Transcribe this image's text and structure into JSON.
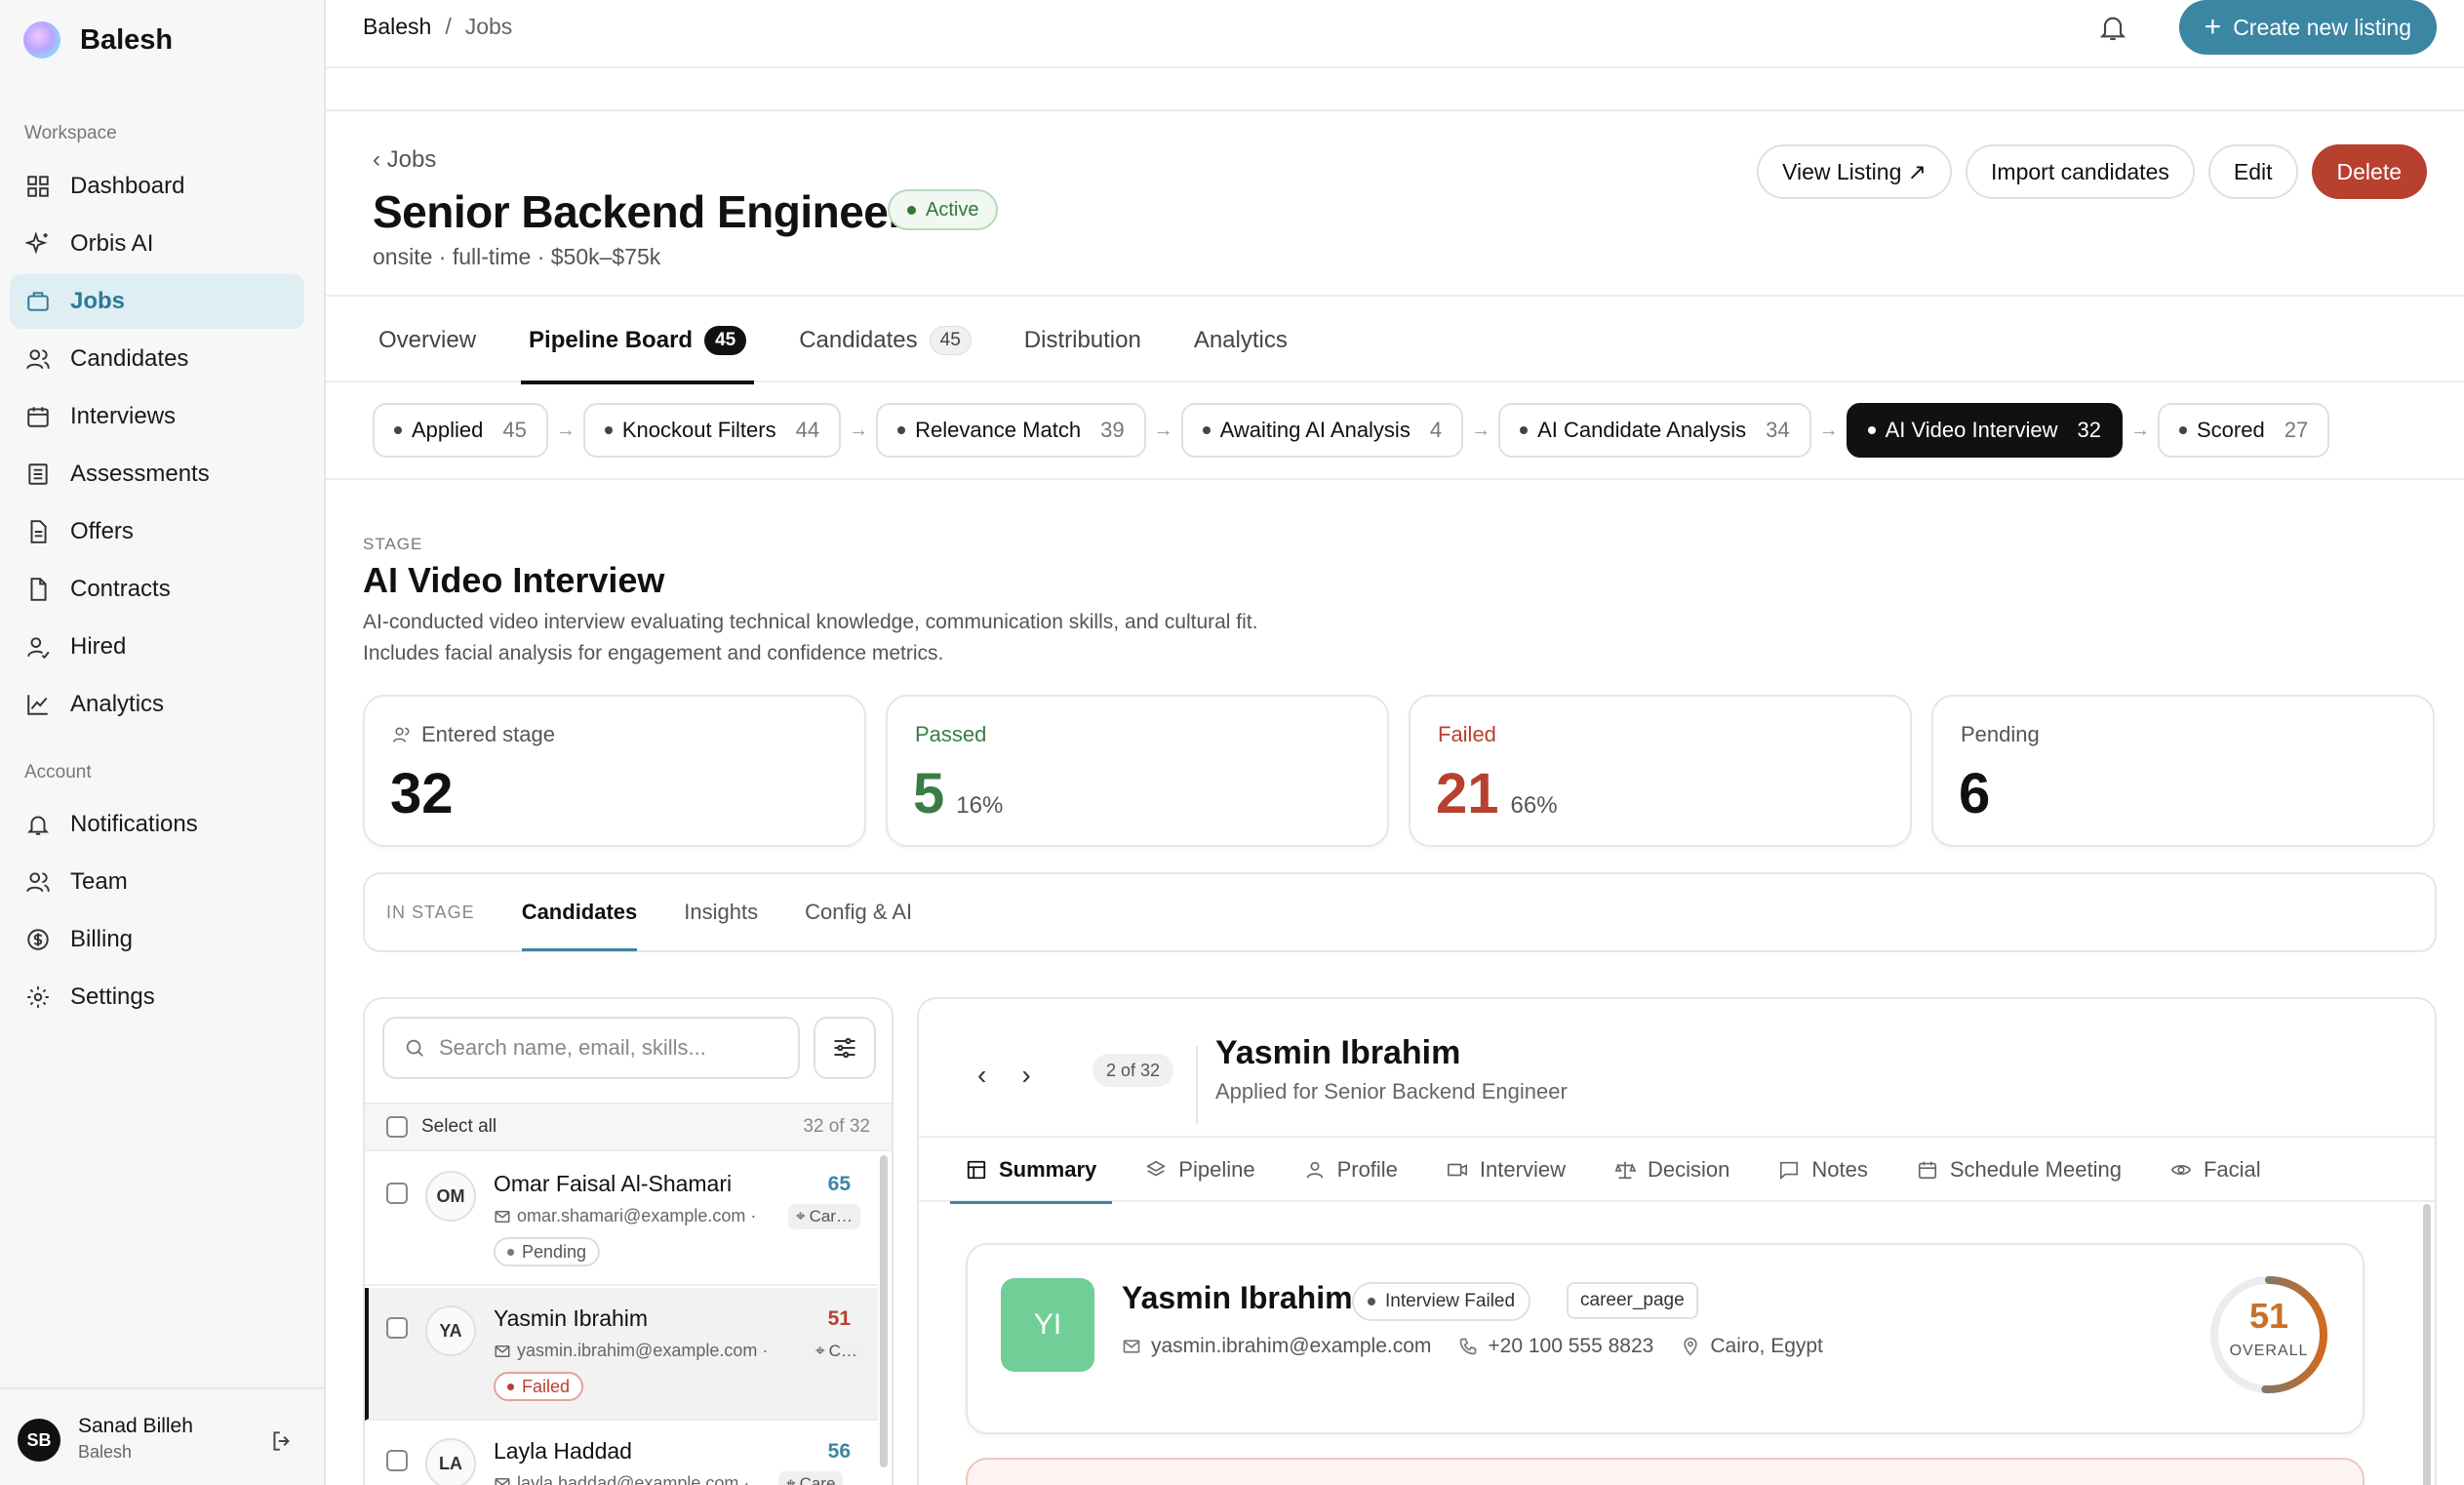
{
  "brand": {
    "name": "Balesh"
  },
  "sidebar": {
    "workspace_label": "Workspace",
    "account_label": "Account",
    "workspace_items": [
      {
        "label": "Dashboard",
        "icon": "dashboard-icon"
      },
      {
        "label": "Orbis AI",
        "icon": "sparkle-icon"
      },
      {
        "label": "Jobs",
        "icon": "briefcase-icon",
        "active": true
      },
      {
        "label": "Candidates",
        "icon": "users-icon"
      },
      {
        "label": "Interviews",
        "icon": "calendar-icon"
      },
      {
        "label": "Assessments",
        "icon": "list-icon"
      },
      {
        "label": "Offers",
        "icon": "document-icon"
      },
      {
        "label": "Contracts",
        "icon": "file-icon"
      },
      {
        "label": "Hired",
        "icon": "user-check-icon"
      },
      {
        "label": "Analytics",
        "icon": "chart-icon"
      }
    ],
    "account_items": [
      {
        "label": "Notifications",
        "icon": "bell-icon"
      },
      {
        "label": "Team",
        "icon": "team-icon"
      },
      {
        "label": "Billing",
        "icon": "dollar-icon"
      },
      {
        "label": "Settings",
        "icon": "gear-icon"
      }
    ],
    "user": {
      "initials": "SB",
      "name": "Sanad Billeh",
      "org": "Balesh"
    }
  },
  "topbar": {
    "breadcrumb": [
      "Balesh",
      "/",
      "Jobs"
    ],
    "create_button": "Create new listing"
  },
  "job": {
    "back": "‹ Jobs",
    "title": "Senior Backend Engineer",
    "status": "Active",
    "meta": "onsite · full-time · $50k–$75k",
    "actions": {
      "view": "View Listing ↗",
      "import": "Import candidates",
      "edit": "Edit",
      "delete": "Delete"
    }
  },
  "tabs": [
    {
      "label": "Overview"
    },
    {
      "label": "Pipeline Board",
      "count": "45",
      "active": true
    },
    {
      "label": "Candidates",
      "count": "45"
    },
    {
      "label": "Distribution"
    },
    {
      "label": "Analytics"
    }
  ],
  "stages": [
    {
      "label": "Applied",
      "count": "45"
    },
    {
      "label": "Knockout Filters",
      "count": "44"
    },
    {
      "label": "Relevance Match",
      "count": "39"
    },
    {
      "label": "Awaiting AI Analysis",
      "count": "4"
    },
    {
      "label": "AI Candidate Analysis",
      "count": "34"
    },
    {
      "label": "AI Video Interview",
      "count": "32",
      "active": true
    },
    {
      "label": "Scored",
      "count": "27"
    }
  ],
  "stage": {
    "label": "STAGE",
    "title": "AI Video Interview",
    "desc1": "AI-conducted video interview evaluating technical knowledge, communication skills, and cultural fit.",
    "desc2": "Includes facial analysis for engagement and confidence metrics."
  },
  "stats": {
    "entered": {
      "label": "Entered stage",
      "value": "32"
    },
    "passed": {
      "label": "Passed",
      "value": "5",
      "pct": "16%",
      "color": "#3a7d44"
    },
    "failed": {
      "label": "Failed",
      "value": "21",
      "pct": "66%",
      "color": "#b8402f"
    },
    "pending": {
      "label": "Pending",
      "value": "6"
    }
  },
  "sub_tabs": {
    "label": "IN STAGE",
    "items": [
      "Candidates",
      "Insights",
      "Config & AI"
    ]
  },
  "list": {
    "search_placeholder": "Search name, email, skills...",
    "select_all": "Select all",
    "count": "32 of 32",
    "candidates": [
      {
        "initials": "OM",
        "name": "Omar Faisal Al-Shamari",
        "email": "omar.shamari@example.com ·",
        "loc": "Car…",
        "score": "65",
        "status": "Pending"
      },
      {
        "initials": "YA",
        "name": "Yasmin Ibrahim",
        "email": "yasmin.ibrahim@example.com ·",
        "loc": "C…",
        "score": "51",
        "status": "Failed"
      },
      {
        "initials": "LA",
        "name": "Layla Haddad",
        "email": "layla.haddad@example.com ·",
        "loc": "Care",
        "score": "56",
        "status": ""
      }
    ]
  },
  "detail": {
    "position": "2 of 32",
    "name": "Yasmin Ibrahim",
    "applied": "Applied for Senior Backend Engineer",
    "tabs": [
      "Summary",
      "Pipeline",
      "Profile",
      "Interview",
      "Decision",
      "Notes",
      "Schedule Meeting",
      "Facial"
    ],
    "summary": {
      "initials": "YI",
      "name": "Yasmin Ibrahim",
      "status": "Interview Failed",
      "source": "career_page",
      "email": "yasmin.ibrahim@example.com",
      "phone": "+20 100 555 8823",
      "location": "Cairo, Egypt",
      "score": "51",
      "score_value": 51,
      "score_label": "OVERALL"
    }
  }
}
